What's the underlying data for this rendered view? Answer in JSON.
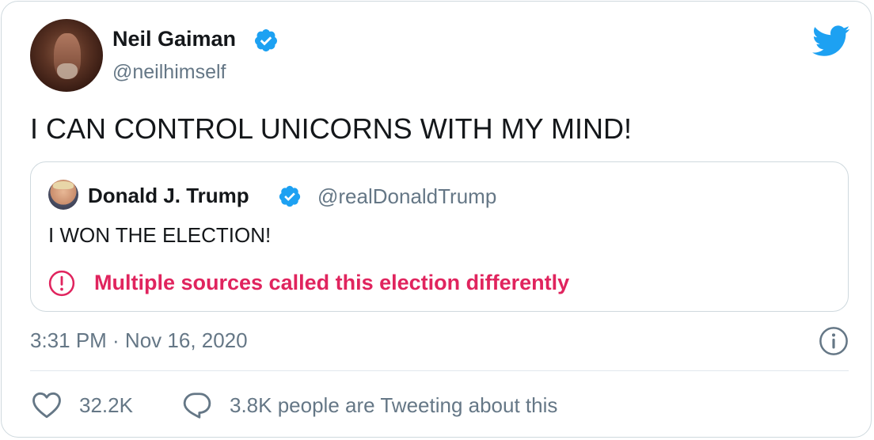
{
  "tweet": {
    "author": {
      "name": "Neil Gaiman",
      "handle": "@neilhimself",
      "verified": true,
      "avatar": "author-portrait"
    },
    "text": "I CAN CONTROL UNICORNS WITH MY MIND!",
    "quoted_tweet": {
      "author": {
        "name": "Donald J. Trump",
        "handle": "@realDonaldTrump",
        "verified": true,
        "avatar": "author-portrait"
      },
      "text": "I WON THE ELECTION!",
      "warning": {
        "icon": "exclamation-circle-icon",
        "text": "Multiple sources called this election differently"
      }
    },
    "timestamp": "3:31 PM · Nov 16, 2020",
    "likes": "32.2K",
    "tweeting": "3.8K people are Tweeting about this"
  },
  "icons": {
    "brand": "twitter-bird-icon",
    "verified": "verified-badge-icon",
    "info": "info-icon",
    "like": "heart-icon",
    "reply": "speech-bubble-icon"
  },
  "colors": {
    "twitter_blue": "#1da1f2",
    "warning_red": "#e0245e",
    "secondary_text": "#657786",
    "border": "#cfd9de"
  }
}
